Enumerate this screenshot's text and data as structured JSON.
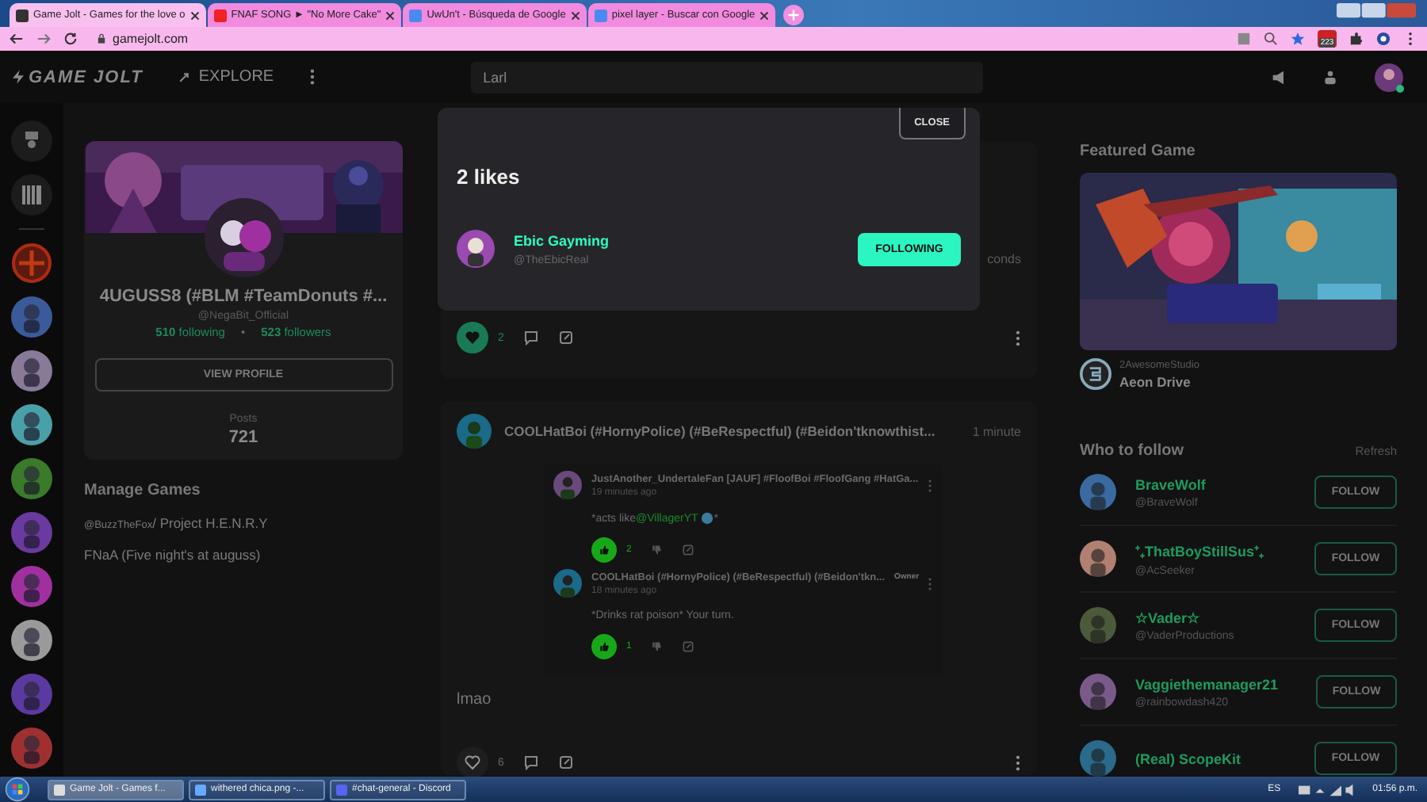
{
  "browser": {
    "tabs": [
      {
        "title": "Game Jolt - Games for the love o",
        "selected": true
      },
      {
        "title": "FNAF SONG ► \"No More Cake\"",
        "selected": false
      },
      {
        "title": "UwUn't - Búsqueda de Google",
        "selected": false
      },
      {
        "title": "pixel layer - Buscar con Google",
        "selected": false
      }
    ],
    "url": "gamejolt.com",
    "extension_badge": "223"
  },
  "nav": {
    "logo": "GAME JOLT",
    "explore": "EXPLORE",
    "search": {
      "value": "Larl"
    }
  },
  "profile": {
    "name": "4UGUSS8 (#BLM #TeamDonuts #...",
    "handle": "@NegaBit_Official",
    "following_count": "510",
    "following_label": "following",
    "separator": "•",
    "followers_count": "523",
    "followers_label": "followers",
    "button": "VIEW PROFILE",
    "posts_label": "Posts",
    "posts_count": "721"
  },
  "manage_games": {
    "title": "Manage Games",
    "items": [
      {
        "owner": "@BuzzTheFox",
        "name": "/ Project H.E.N.R.Y"
      },
      {
        "name": "FNaA (Five night's at auguss)"
      }
    ]
  },
  "feed": [
    {
      "time": "conds",
      "liked": true,
      "likes": "2"
    },
    {
      "author": "COOLHatBoi (#HornyPolice) (#BeRespectful) (#Beidon'tknowthist...",
      "time": "1 minute",
      "comments": [
        {
          "author": "JustAnother_UndertaleFan [JAUF] #FloofBoi #FloofGang #HatGa...",
          "time": "19 minutes ago",
          "text_before": "*acts like ",
          "mention": "@VillagerYT",
          "text_after": "*",
          "liked": true,
          "likes": "2"
        },
        {
          "author": "COOLHatBoi (#HornyPolice) (#BeRespectful) (#Beidon'tkn...",
          "badge": "Owner",
          "time": "18 minutes ago",
          "text_before": "*Drinks rat poison* Your turn.",
          "liked": true,
          "likes": "1"
        }
      ],
      "body": "lmao",
      "liked": false,
      "likes": "6"
    }
  ],
  "likes_modal": {
    "close": "CLOSE",
    "title": "2 likes",
    "users": [
      {
        "name": "Ebic Gayming",
        "handle": "@TheEbicReal",
        "button": "FOLLOWING",
        "following": true
      }
    ]
  },
  "featured": {
    "title": "Featured Game",
    "studio": "2AwesomeStudio",
    "game": "Aeon Drive"
  },
  "who_to_follow": {
    "title": "Who to follow",
    "refresh": "Refresh",
    "users": [
      {
        "name": "BraveWolf",
        "handle": "@BraveWolf",
        "button": "FOLLOW",
        "following": false
      },
      {
        "name": "⁺₊ThatBoyStillSus⁺₊",
        "handle": "@AcSeeker",
        "button": "FOLLOW",
        "following": false
      },
      {
        "name": "☆Vader☆",
        "handle": "@VaderProductions",
        "button": "FOLLOW",
        "following": false
      },
      {
        "name": "Vaggiethemanager21",
        "handle": "@rainbowdash420",
        "button": "FOLLOW",
        "following": false
      },
      {
        "name": "(Real) ScopeKit",
        "button": "FOLLOW",
        "following": false
      }
    ]
  },
  "taskbar": {
    "tasks": [
      {
        "title": "Game Jolt - Games f...",
        "selected": true
      },
      {
        "title": "withered chica.png -...",
        "selected": false
      },
      {
        "title": "#chat-general - Discord",
        "selected": false
      }
    ],
    "language": "ES",
    "clock": "01:56 p.m."
  }
}
